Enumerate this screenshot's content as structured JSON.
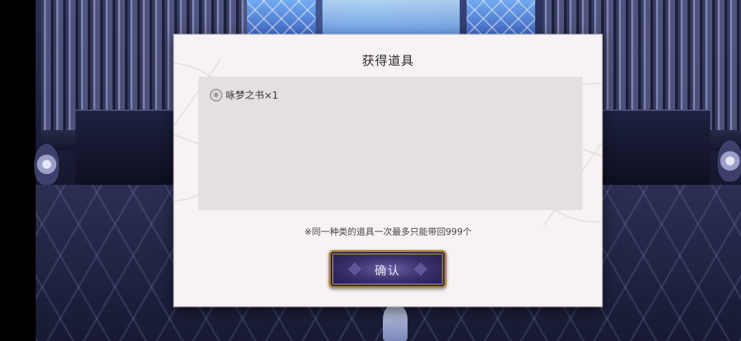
{
  "dialog": {
    "title": "获得道具",
    "items": [
      {
        "icon": "book-icon",
        "icon_glyph": "⁜",
        "label": "咏梦之书×1"
      }
    ],
    "notice": "※同一种类的道具一次最多只能带回999个",
    "confirm_label": "确认"
  },
  "colors": {
    "dialog_bg": "#f7f3f4",
    "panel_bg": "#e6dfe1",
    "button_purple": "#3b3270",
    "button_gold": "#b08a43"
  }
}
